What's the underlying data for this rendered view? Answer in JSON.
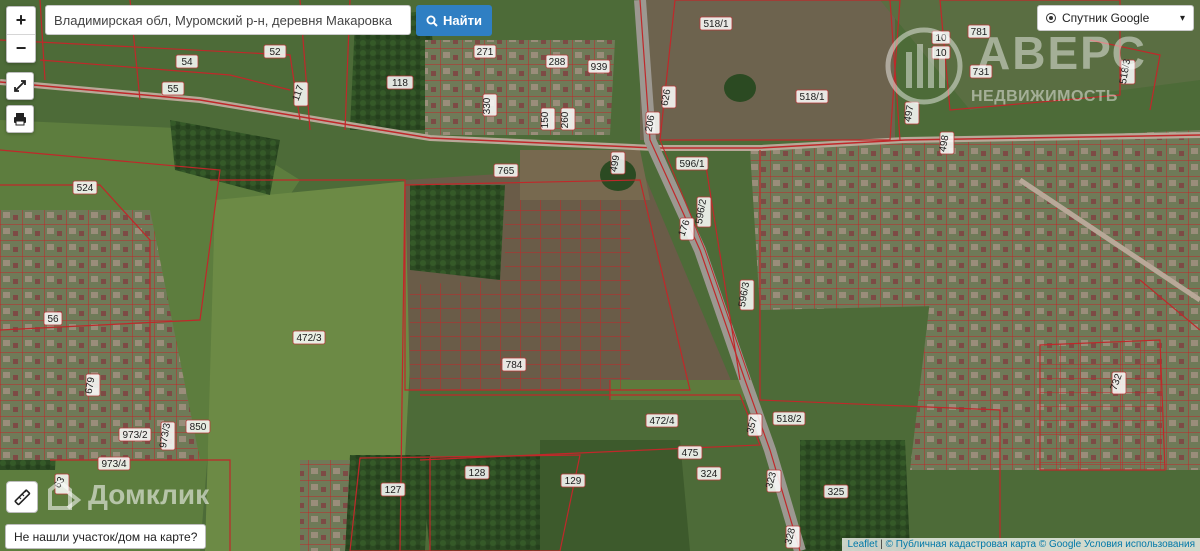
{
  "search": {
    "value": "Владимирская обл, Муромский р-н, деревня Макаровка",
    "button_label": "Найти"
  },
  "controls": {
    "zoom_in": "+",
    "zoom_out": "−",
    "not_found_label": "Не нашли участок/дом на карте?"
  },
  "layer": {
    "selected": "Спутник Google"
  },
  "watermarks": {
    "domclick": "Домклик",
    "avers_title": "АВЕРС",
    "avers_subtitle": "НЕДВИЖИМОСТЬ"
  },
  "attribution": {
    "leaflet": "Leaflet",
    "sep": " | ",
    "pkk": "© Публичная кадастровая карта",
    "google": "© Google",
    "terms": "Условия использования"
  },
  "parcels": [
    "54",
    "52",
    "55",
    "118",
    "117",
    "271",
    "288",
    "939",
    "330",
    "150",
    "260",
    "518/1",
    "518/1",
    "626",
    "206",
    "781",
    "10",
    "10",
    "731",
    "518/3",
    "497",
    "498",
    "765",
    "596/1",
    "596/2",
    "176",
    "596/3",
    "524",
    "56",
    "472/3",
    "784",
    "679",
    "973/2",
    "973/3",
    "850",
    "973/4",
    "472/4",
    "475",
    "324",
    "357",
    "518/2",
    "128",
    "127",
    "129",
    "325",
    "323",
    "328",
    "732",
    "63"
  ],
  "colors": {
    "parcel_outline": "#c0282a",
    "search_button": "#2f7fc3"
  }
}
